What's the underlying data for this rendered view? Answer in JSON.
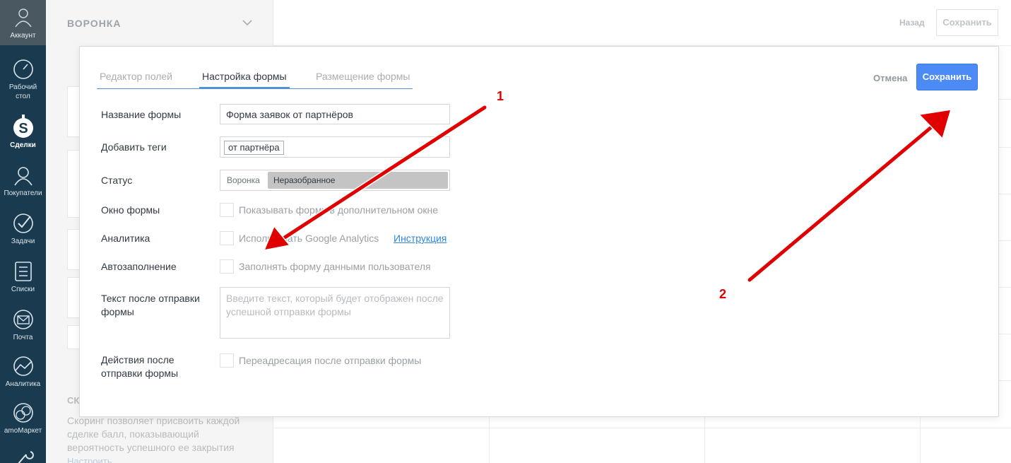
{
  "sidebar": {
    "account_label": "Аккаунт",
    "items": [
      {
        "label_line1": "Рабочий",
        "label_line2": "стол",
        "icon": "dashboard-icon"
      },
      {
        "label_line1": "Сделки",
        "label_line2": "",
        "icon": "deals-icon"
      },
      {
        "label_line1": "Покупатели",
        "label_line2": "",
        "icon": "customers-icon"
      },
      {
        "label_line1": "Задачи",
        "label_line2": "",
        "icon": "tasks-icon"
      },
      {
        "label_line1": "Списки",
        "label_line2": "",
        "icon": "lists-icon"
      },
      {
        "label_line1": "Почта",
        "label_line2": "",
        "icon": "mail-icon"
      },
      {
        "label_line1": "Аналитика",
        "label_line2": "",
        "icon": "analytics-icon"
      },
      {
        "label_line1": "amoМаркет",
        "label_line2": "",
        "icon": "market-icon"
      }
    ]
  },
  "background": {
    "funnel_title": "ВОРОНКА",
    "back_label": "Назад",
    "save_label": "Сохранить",
    "section_title": "СК",
    "scoring_text": "Скоринг позволяет присвоить каждой сделке балл, показывающий вероятность успешного ее закрытия",
    "setup_link": "Настроить"
  },
  "modal": {
    "tabs": [
      "Редактор полей",
      "Настройка формы",
      "Размещение формы"
    ],
    "active_tab": 1,
    "cancel_label": "Отмена",
    "save_label": "Сохранить",
    "fields": {
      "form_name_label": "Название формы",
      "form_name_value": "Форма заявок от партнёров",
      "tags_label": "Добавить теги",
      "tag_value": "от партнёра",
      "status_label": "Статус",
      "status_prefix": "Воронка",
      "status_value": "Неразобранное",
      "window_label": "Окно формы",
      "window_option": "Показывать форму в дополнительном окне",
      "analytics_label": "Аналитика",
      "analytics_option": "Использовать Google Analytics",
      "analytics_link": "Инструкция",
      "autofill_label": "Автозаполнение",
      "autofill_option": "Заполнять форму данными пользователя",
      "after_text_label_line1": "Текст после отправки",
      "after_text_label_line2": "формы",
      "after_text_placeholder": "Введите текст, который будет отображен после успешной отправки формы",
      "actions_label_line1": "Действия после",
      "actions_label_line2": "отправки формы",
      "actions_option": "Переадресация после отправки формы"
    }
  },
  "annotations": {
    "one": "1",
    "two": "2"
  },
  "colors": {
    "accent": "#4c8bf5",
    "sidebar": "#1a3b4f",
    "arrow": "#e00000"
  }
}
